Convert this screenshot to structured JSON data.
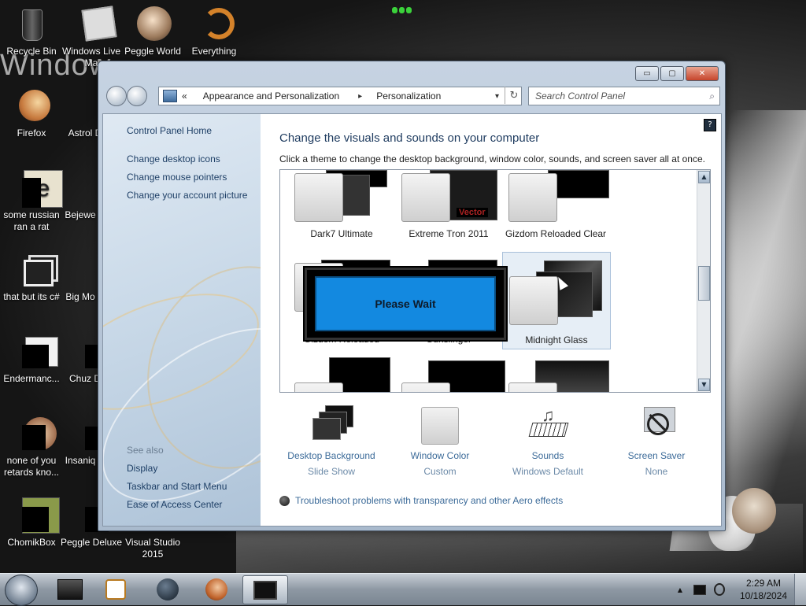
{
  "desktop": {
    "wallpaper_text": "Window",
    "icons": [
      {
        "label": "Recycle Bin"
      },
      {
        "label": "Windows Live Ma"
      },
      {
        "label": "Peggle World"
      },
      {
        "label": "Everything"
      },
      {
        "label": "Firefox"
      },
      {
        "label": "Astrol Delu"
      },
      {
        "label": "some russian ran a rat"
      },
      {
        "label": "Bejewe Delu"
      },
      {
        "label": "that but its c#"
      },
      {
        "label": "Big Mo Delu"
      },
      {
        "label": "Endermanc..."
      },
      {
        "label": "Chuz Delu"
      },
      {
        "label": "none of you retards kno..."
      },
      {
        "label": "Insaniq Delu"
      },
      {
        "label": "ChomikBox"
      },
      {
        "label": "Peggle Deluxe"
      },
      {
        "label": "Visual Studio 2015"
      }
    ]
  },
  "window": {
    "titlebar": {
      "minimize": "▭",
      "maximize": "▢",
      "close": "✕"
    },
    "address": {
      "chevron": "«",
      "crumb1": "Appearance and Personalization",
      "sep": "▸",
      "crumb2": "Personalization",
      "dropdown": "▾",
      "refresh": "↻"
    },
    "search": {
      "placeholder": "Search Control Panel",
      "icon": "⌕"
    },
    "sidebar": {
      "home": "Control Panel Home",
      "links": [
        "Change desktop icons",
        "Change mouse pointers",
        "Change your account picture"
      ],
      "see_also": "See also",
      "see_also_links": [
        "Display",
        "Taskbar and Start Menu",
        "Ease of Access Center"
      ]
    },
    "main": {
      "help": "?",
      "heading": "Change the visuals and sounds on your computer",
      "subheading": "Click a theme to change the desktop background, window color, sounds, and screen saver all at once.",
      "themes": [
        {
          "name": "Dark7 Ultimate"
        },
        {
          "name": "Extreme Tron 2011",
          "badge": "Vector"
        },
        {
          "name": "Gizdom Reloaded Clear"
        },
        {
          "name": "Gizdom Reloaded"
        },
        {
          "name": "Gunslinger"
        },
        {
          "name": "Midnight Glass",
          "selected": true
        },
        {
          "name": ""
        },
        {
          "name": ""
        },
        {
          "name": ""
        }
      ],
      "please_wait": "Please Wait",
      "scroll_up": "▲",
      "scroll_down": "▼",
      "bottom": [
        {
          "title": "Desktop Background",
          "value": "Slide Show"
        },
        {
          "title": "Window Color",
          "value": "Custom"
        },
        {
          "title": "Sounds",
          "value": "Windows Default"
        },
        {
          "title": "Screen Saver",
          "value": "None"
        }
      ],
      "troubleshoot": "Troubleshoot problems with transparency and other Aero effects"
    }
  },
  "taskbar": {
    "tray_arrow": "▲",
    "time": "2:29 AM",
    "date": "10/18/2024"
  },
  "colors": {
    "link": "#1e3f66",
    "heading": "#1e3b5f",
    "please_wait_bg": "#1389e0",
    "bottom_link": "#3c6b99"
  }
}
